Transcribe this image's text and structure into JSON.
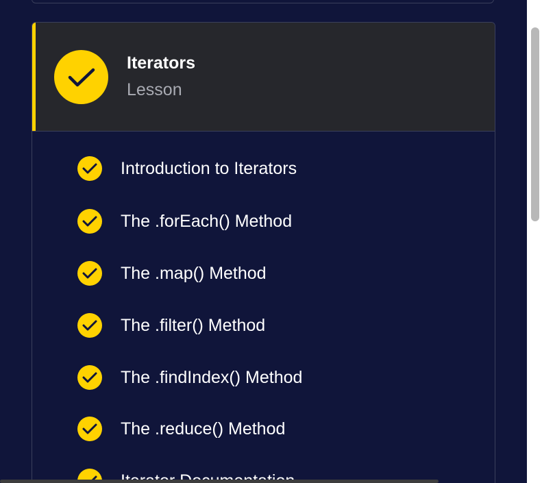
{
  "lesson": {
    "title": "Iterators",
    "subtitle": "Lesson",
    "status_icon": "checkmark-icon",
    "accent_color": "#ffd200"
  },
  "items": [
    {
      "label": "Introduction to Iterators",
      "completed": true
    },
    {
      "label": "The .forEach() Method",
      "completed": true
    },
    {
      "label": "The .map() Method",
      "completed": true
    },
    {
      "label": "The .filter() Method",
      "completed": true
    },
    {
      "label": "The .findIndex() Method",
      "completed": true
    },
    {
      "label": "The .reduce() Method",
      "completed": true
    },
    {
      "label": "Iterator Documentation",
      "completed": true
    }
  ],
  "colors": {
    "panel_bg": "#10153a",
    "header_bg": "#26272c",
    "check_yellow": "#ffd200",
    "text_primary": "#ffffff",
    "text_secondary": "#a9abb3"
  }
}
